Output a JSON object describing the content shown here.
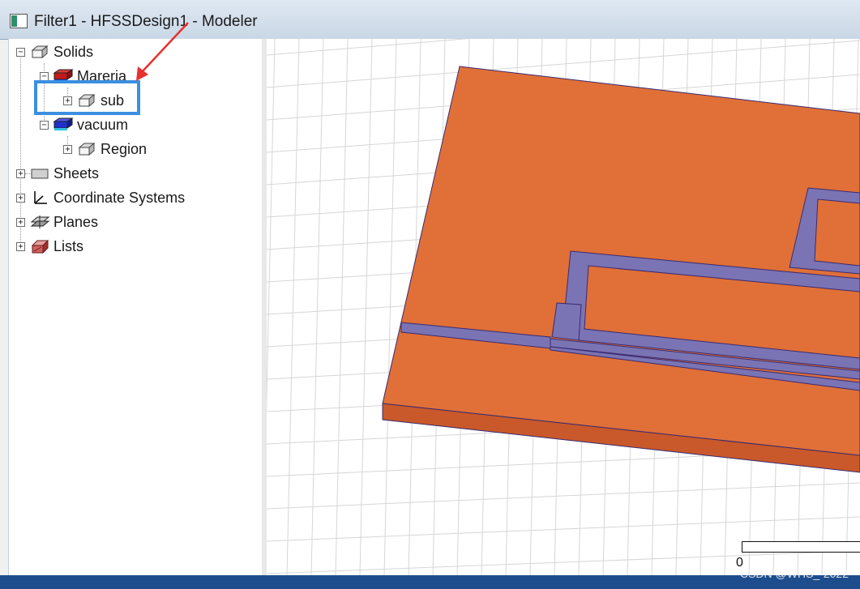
{
  "window": {
    "title": "Filter1 - HFSSDesign1 - Modeler"
  },
  "tree": {
    "items": [
      {
        "label": "Solids",
        "expander": "−",
        "icon": "solid-box-icon"
      },
      {
        "label": "Mareria",
        "expander": "−",
        "icon": "material-icon",
        "color": "#d22020"
      },
      {
        "label": "sub",
        "expander": "+",
        "icon": "solid-box-icon"
      },
      {
        "label": "vacuum",
        "expander": "−",
        "icon": "material-icon",
        "color": "#2030d0"
      },
      {
        "label": "Region",
        "expander": "+",
        "icon": "solid-box-icon"
      },
      {
        "label": "Sheets",
        "expander": "+",
        "icon": "sheet-icon"
      },
      {
        "label": "Coordinate Systems",
        "expander": "+",
        "icon": "coordinate-axes-icon"
      },
      {
        "label": "Planes",
        "expander": "+",
        "icon": "planes-icon"
      },
      {
        "label": "Lists",
        "expander": "+",
        "icon": "list-icon"
      }
    ]
  },
  "viewport": {
    "substrate_color": "#e07038",
    "metal_color": "#7a74b4",
    "scale_label": "0"
  },
  "watermark": "CSDN @WHS_-2022"
}
